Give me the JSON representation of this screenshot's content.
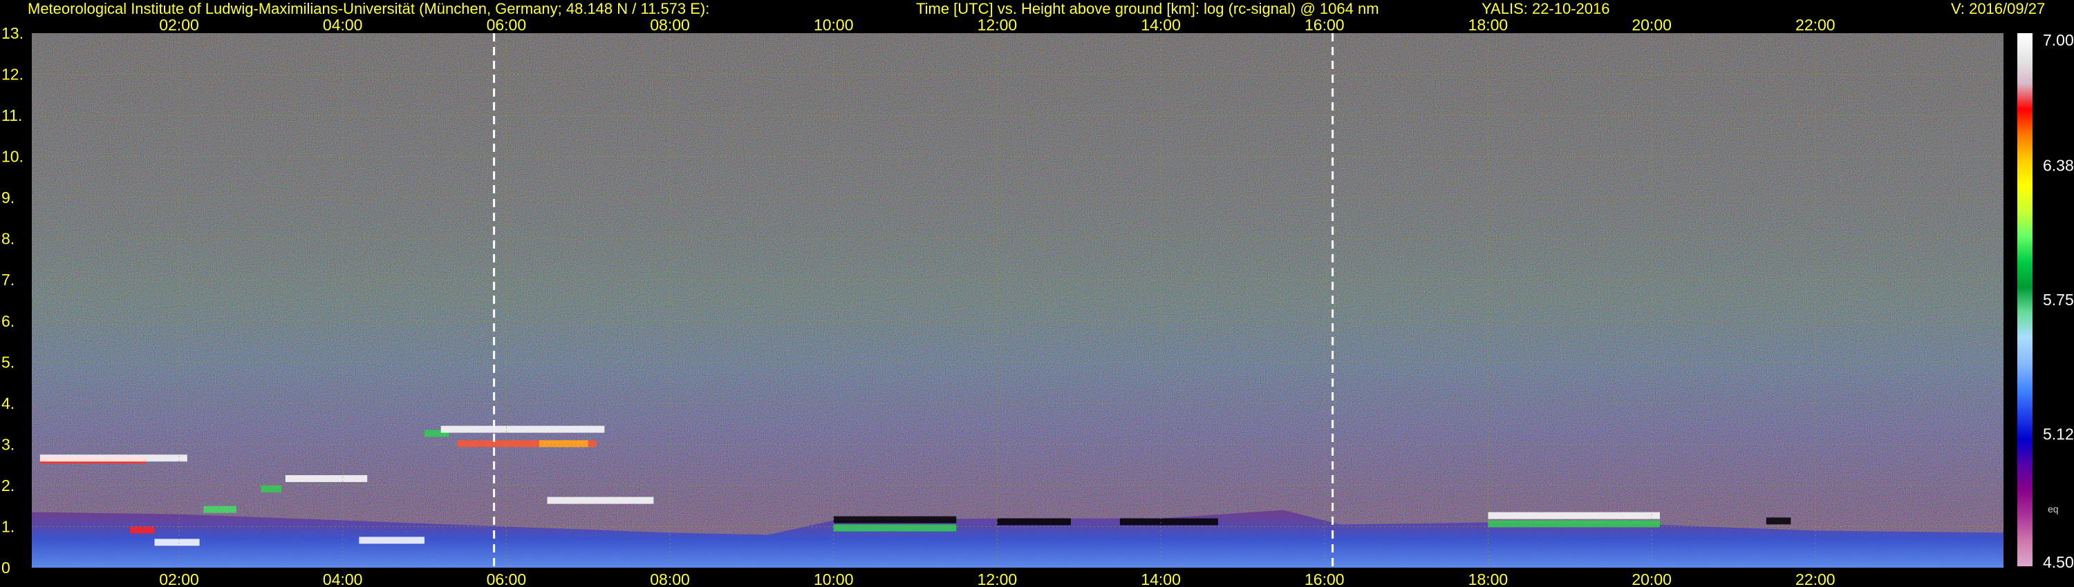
{
  "header": {
    "institute": "Meteorological Institute of Ludwig-Maximilians-Universität (München, Germany; 48.148 N / 11.573 E):",
    "description": "Time [UTC] vs. Height above ground [km]: log (rc-signal) @ 1064 nm",
    "instrument_date": "YALIS: 22-10-2016",
    "version": "V: 2016/09/27"
  },
  "colorbar": {
    "tick_labels": [
      "7.00",
      "6.38",
      "5.75",
      "5.12",
      "4.50"
    ],
    "tick_values": [
      7.0,
      6.38,
      5.75,
      5.12,
      4.5
    ],
    "range": [
      4.5,
      7.0
    ],
    "small_label": "eq",
    "colors": [
      "#ffffff",
      "#e6e6e6",
      "#d8b8c8",
      "#ff0000",
      "#ff7700",
      "#ffcc00",
      "#ffff00",
      "#ccff33",
      "#66ff66",
      "#00cc44",
      "#009933",
      "#66dd99",
      "#aaddff",
      "#88bbff",
      "#4488ff",
      "#2244ee",
      "#0000cc",
      "#5500aa",
      "#880088",
      "#aa3399",
      "#cc77aa",
      "#ddaacc"
    ]
  },
  "chart_data": {
    "type": "heatmap",
    "title": "Time [UTC] vs. Height above ground [km]: log (rc-signal) @ 1064 nm",
    "xlabel": "Time [UTC]",
    "ylabel": "Height above ground [km]",
    "x_ticks": [
      "02:00",
      "04:00",
      "06:00",
      "08:00",
      "10:00",
      "12:00",
      "14:00",
      "16:00",
      "18:00",
      "20:00",
      "22:00"
    ],
    "x_tick_hours": [
      2,
      4,
      6,
      8,
      10,
      12,
      14,
      16,
      18,
      20,
      22
    ],
    "xlim_hours": [
      0.2,
      24.3
    ],
    "y_ticks": [
      "0",
      "1.",
      "2.",
      "3.",
      "4.",
      "5.",
      "6.",
      "7.",
      "8.",
      "9.",
      "10.",
      "11.",
      "12.",
      "13."
    ],
    "y_tick_values": [
      0,
      1,
      2,
      3,
      4,
      5,
      6,
      7,
      8,
      9,
      10,
      11,
      12,
      13
    ],
    "ylim": [
      0,
      13
    ],
    "marked_times_hours": [
      5.85,
      16.1
    ],
    "grid": true,
    "colorscale": "log (rc-signal)",
    "zlim": [
      4.5,
      7.0
    ]
  }
}
